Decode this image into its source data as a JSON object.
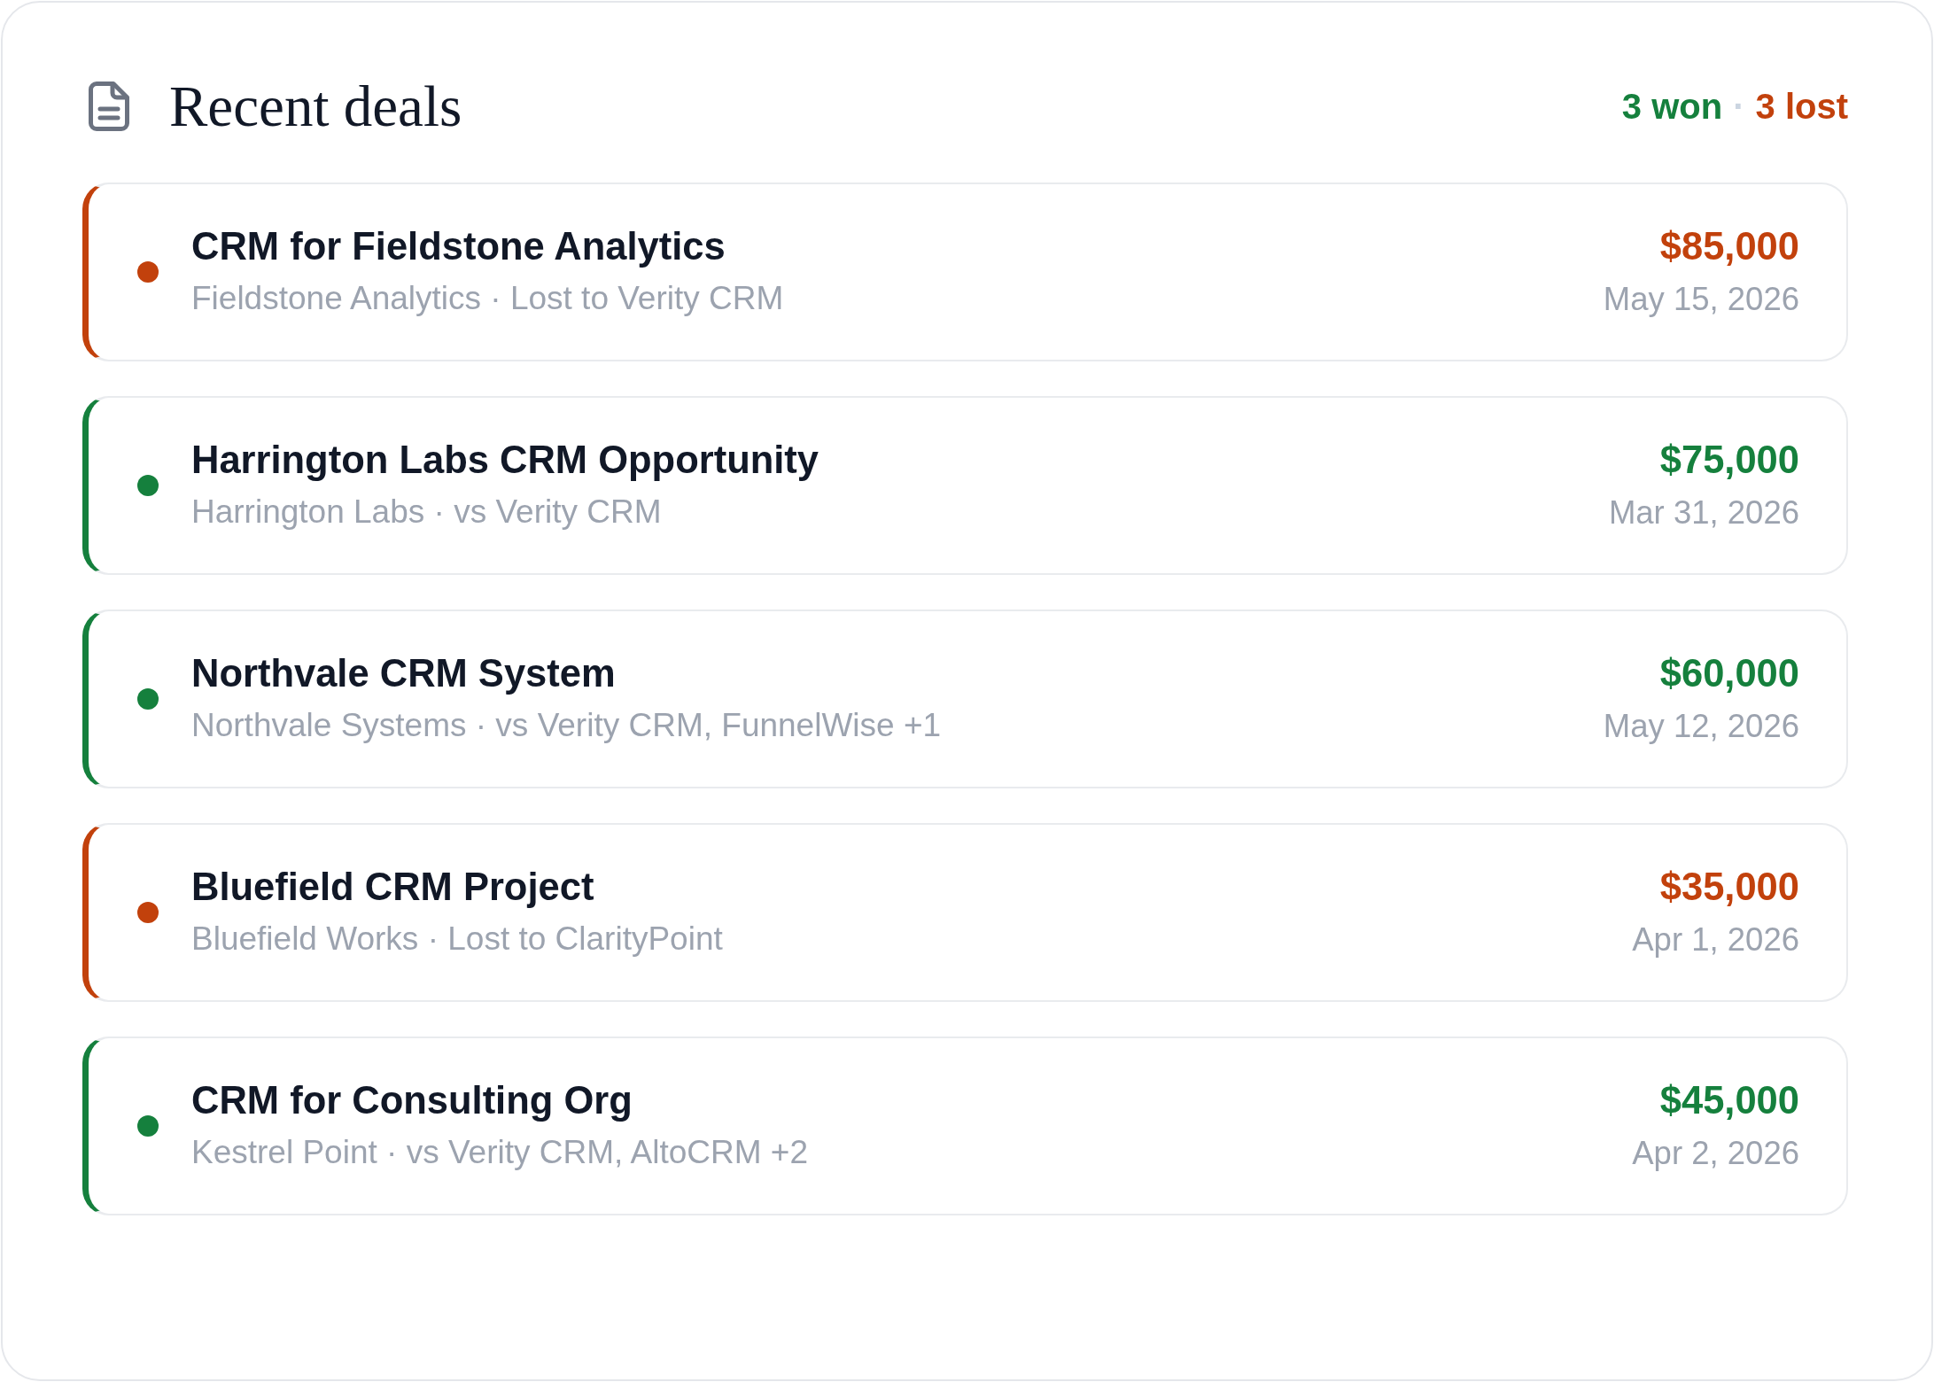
{
  "header": {
    "title": "Recent deals",
    "summary": {
      "won": "3 won",
      "separator": "·",
      "lost": "3 lost"
    }
  },
  "deals": [
    {
      "name": "CRM for Fieldstone Analytics",
      "details": "Fieldstone Analytics · Lost to Verity CRM",
      "amount": "$85,000",
      "date": "May 15, 2026",
      "color": "#c2410c"
    },
    {
      "name": "Harrington Labs CRM Opportunity",
      "details": "Harrington Labs · vs Verity CRM",
      "amount": "$75,000",
      "date": "Mar 31, 2026",
      "color": "#15803d"
    },
    {
      "name": "Northvale CRM System",
      "details": "Northvale Systems · vs Verity CRM, FunnelWise +1",
      "amount": "$60,000",
      "date": "May 12, 2026",
      "color": "#15803d"
    },
    {
      "name": "Bluefield CRM Project",
      "details": "Bluefield Works · Lost to ClarityPoint",
      "amount": "$35,000",
      "date": "Apr 1, 2026",
      "color": "#c2410c"
    },
    {
      "name": "CRM for Consulting Org",
      "details": "Kestrel Point · vs Verity CRM, AltoCRM +2",
      "amount": "$45,000",
      "date": "Apr 2, 2026",
      "color": "#15803d"
    }
  ]
}
